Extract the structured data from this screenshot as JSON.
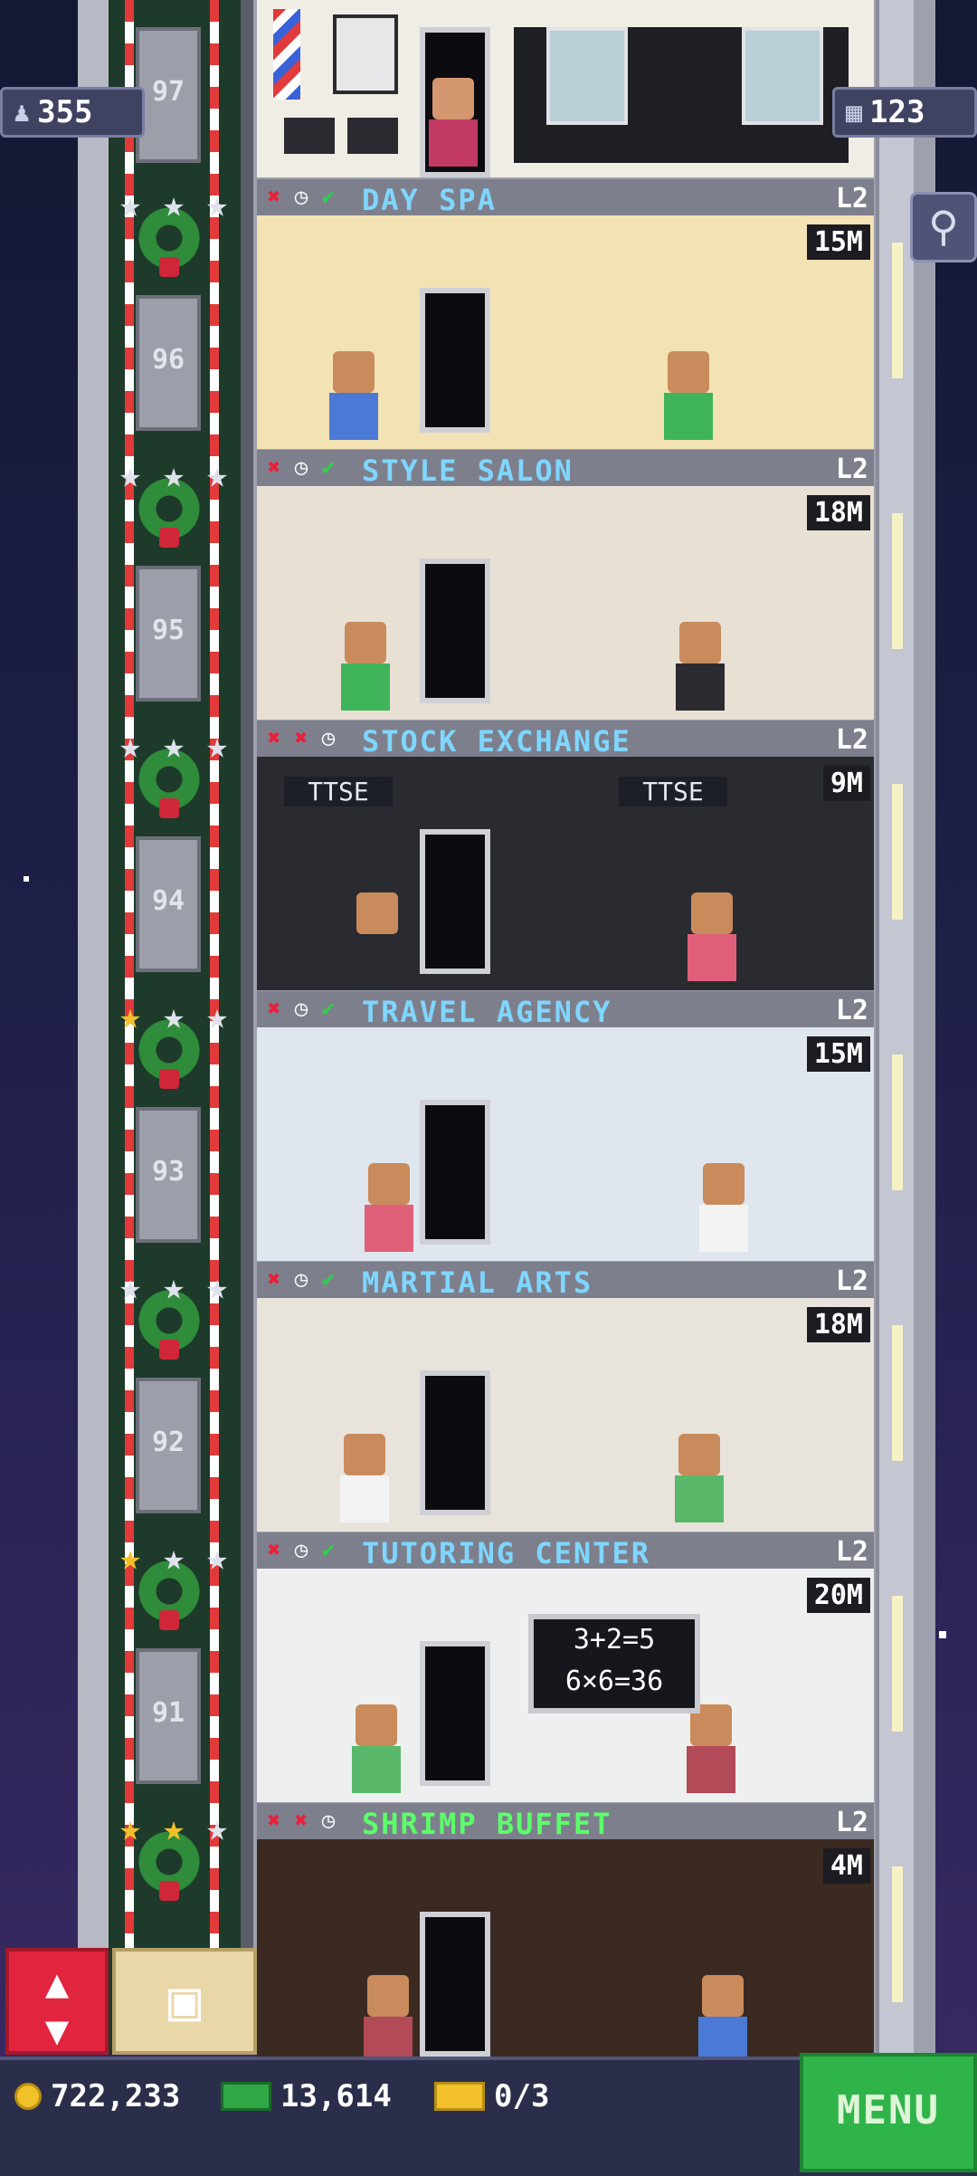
{
  "top_bar": {
    "population": "355",
    "floors_count": "123"
  },
  "floors": [
    {
      "name": "DAY SPA",
      "level": "L2",
      "price": "15M",
      "elevator_floor": "96",
      "stars": [
        "silver",
        "silver",
        "silver"
      ],
      "status": [
        "x",
        "clock",
        "check"
      ],
      "color": "#7fd6ff"
    },
    {
      "name": "STYLE SALON",
      "level": "L2",
      "price": "18M",
      "elevator_floor": "95",
      "stars": [
        "silver",
        "silver",
        "silver"
      ],
      "status": [
        "x",
        "clock",
        "check"
      ],
      "color": "#7fd6ff"
    },
    {
      "name": "STOCK EXCHANGE",
      "level": "L2",
      "price": "9M",
      "elevator_floor": "94",
      "stars": [
        "silver",
        "silver",
        "silver"
      ],
      "status": [
        "x",
        "x",
        "clock"
      ],
      "color": "#7fd6ff",
      "signs": [
        "TTSE",
        "TTSE"
      ]
    },
    {
      "name": "TRAVEL AGENCY",
      "level": "L2",
      "price": "15M",
      "elevator_floor": "93",
      "stars": [
        "gold",
        "silver",
        "silver"
      ],
      "status": [
        "x",
        "clock",
        "check"
      ],
      "color": "#7fd6ff"
    },
    {
      "name": "MARTIAL ARTS",
      "level": "L2",
      "price": "18M",
      "elevator_floor": "92",
      "stars": [
        "silver",
        "silver",
        "silver"
      ],
      "status": [
        "x",
        "clock",
        "check"
      ],
      "color": "#7fd6ff"
    },
    {
      "name": "TUTORING CENTER",
      "level": "L2",
      "price": "20M",
      "elevator_floor": "91",
      "stars": [
        "gold",
        "silver",
        "silver"
      ],
      "status": [
        "x",
        "clock",
        "check"
      ],
      "color": "#7fd6ff",
      "board": [
        "3+2=5",
        "6×6=36"
      ]
    },
    {
      "name": "SHRIMP BUFFET",
      "level": "L2",
      "price": "4M",
      "elevator_floor": "",
      "stars": [
        "gold",
        "gold",
        "silver"
      ],
      "status": [
        "x",
        "x",
        "clock"
      ],
      "color": "#5cff6a"
    }
  ],
  "top_elevator_floor": "97",
  "bottom_bar": {
    "coins": "722,233",
    "bux": "13,614",
    "tickets": "0/3",
    "menu_label": "MENU"
  },
  "icons": {
    "elevator": "up-down-arrows",
    "storage": "box",
    "zoom": "magnifier",
    "population": "person",
    "floors": "building"
  }
}
